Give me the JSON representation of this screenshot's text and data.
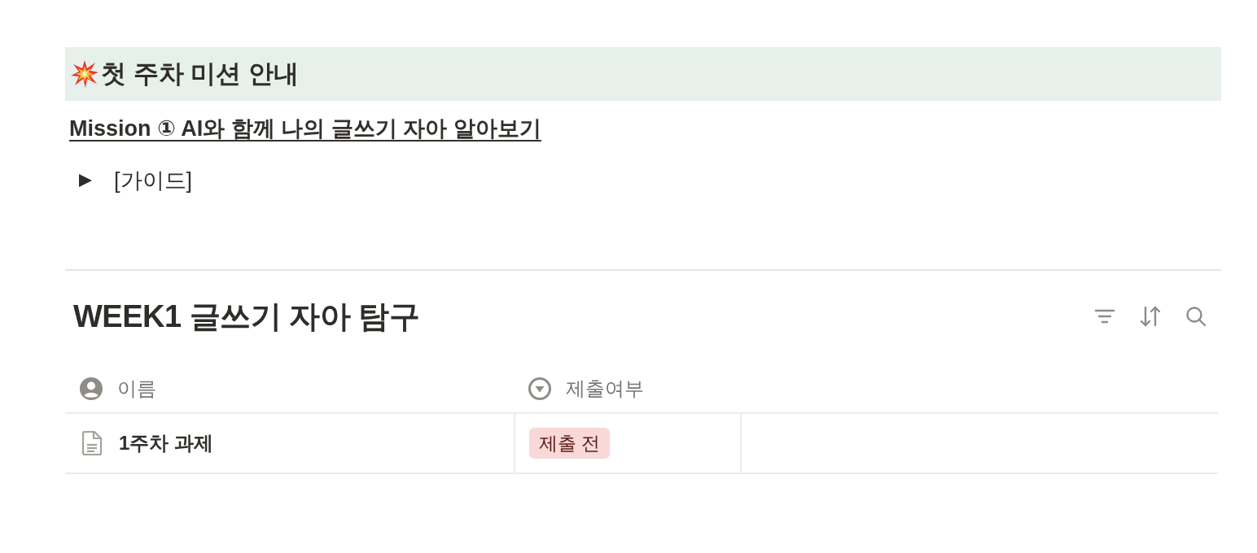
{
  "callout_heading": {
    "text": "첫 주차 미션 안내"
  },
  "mission_link": {
    "text": "Mission ① AI와 함께 나의 글쓰기 자아 알아보기"
  },
  "toggle": {
    "label": "[가이드]",
    "expanded": false
  },
  "database": {
    "title": "WEEK1 글쓰기 자아 탐구",
    "columns": [
      {
        "label": "이름",
        "kind": "title"
      },
      {
        "label": "제출여부",
        "kind": "select"
      }
    ],
    "rows": [
      {
        "name": "1주차 과제",
        "status": {
          "label": "제출 전",
          "color": "#f8d9d7"
        }
      }
    ]
  }
}
